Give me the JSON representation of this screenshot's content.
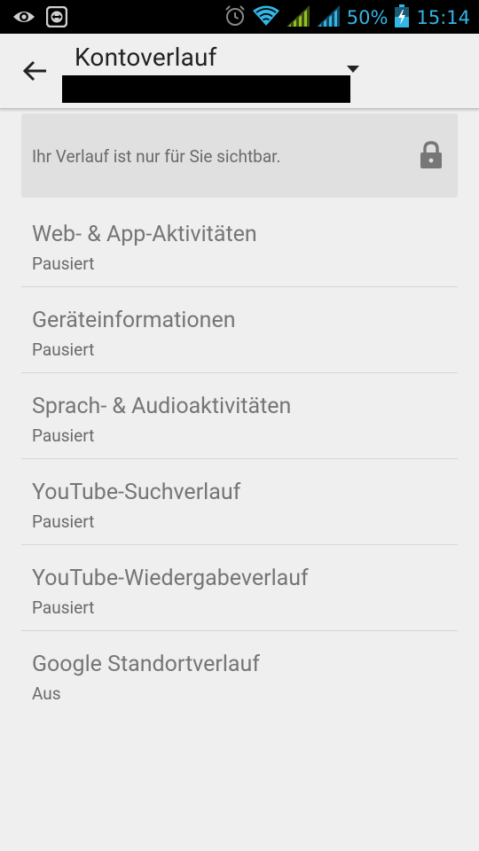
{
  "status_bar": {
    "left_icons": [
      "eye-icon",
      "teamviewer-icon"
    ],
    "right_icons": [
      "alarm-icon",
      "wifi-icon",
      "signal-icon",
      "signal-icon",
      "battery-charging-icon"
    ],
    "battery": "50%",
    "time": "15:14",
    "accent": "#33b5e5"
  },
  "toolbar": {
    "back_icon": "back-arrow-icon",
    "title": "Kontoverlauf",
    "dropdown_icon": "dropdown-triangle-icon"
  },
  "banner": {
    "text": "Ihr Verlauf ist nur für Sie sichtbar.",
    "icon": "lock-icon"
  },
  "list": {
    "items": [
      {
        "title": "Web- & App-Aktivitäten",
        "status": "Pausiert"
      },
      {
        "title": "Geräteinformationen",
        "status": "Pausiert"
      },
      {
        "title": "Sprach- & Audioaktivitäten",
        "status": "Pausiert"
      },
      {
        "title": "YouTube-Suchverlauf",
        "status": "Pausiert"
      },
      {
        "title": "YouTube-Wiedergabeverlauf",
        "status": "Pausiert"
      },
      {
        "title": "Google Standortverlauf",
        "status": "Aus"
      }
    ]
  }
}
